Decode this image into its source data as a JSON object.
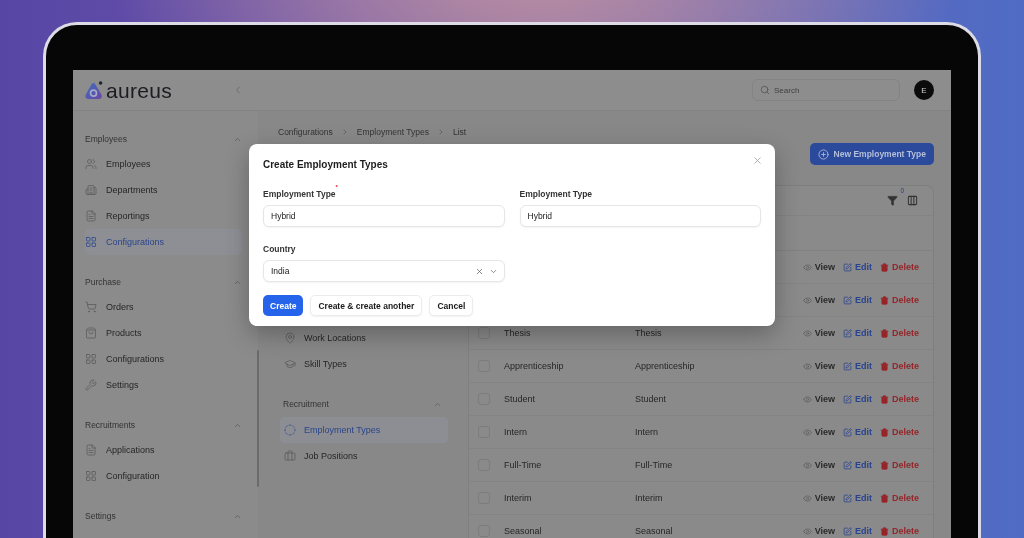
{
  "logo": {
    "text": "aureus"
  },
  "topbar": {
    "search": {
      "placeholder": "Search"
    },
    "avatar": "E"
  },
  "sidebar": {
    "groups": [
      {
        "label": "Employees",
        "expanded": true,
        "items": [
          {
            "label": "Employees",
            "selected": false
          },
          {
            "label": "Departments",
            "selected": false
          },
          {
            "label": "Reportings",
            "selected": false
          },
          {
            "label": "Configurations",
            "selected": true
          }
        ]
      },
      {
        "label": "Purchase",
        "expanded": true,
        "items": [
          {
            "label": "Orders",
            "selected": false
          },
          {
            "label": "Products",
            "selected": false
          },
          {
            "label": "Configurations",
            "selected": false
          },
          {
            "label": "Settings",
            "selected": false
          }
        ]
      },
      {
        "label": "Recruitments",
        "expanded": true,
        "items": [
          {
            "label": "Applications",
            "selected": false
          },
          {
            "label": "Configuration",
            "selected": false
          }
        ]
      },
      {
        "label": "Settings",
        "expanded": true
      }
    ]
  },
  "breadcrumb": [
    "Configurations",
    "Employment Types",
    "List"
  ],
  "new_button": {
    "label": "New Employment Type"
  },
  "subnav": {
    "groups": [
      {
        "items": [
          {
            "label": "Work Locations",
            "selected": false
          },
          {
            "label": "Skill Types",
            "selected": false
          }
        ]
      },
      {
        "label": "Recruitment",
        "expanded": true,
        "items": [
          {
            "label": "Employment Types",
            "selected": true
          },
          {
            "label": "Job Positions",
            "selected": false
          }
        ]
      }
    ]
  },
  "table": {
    "filter_count": "0",
    "rows": [
      {
        "actions": [
          {
            "kind": "view",
            "label": "View"
          },
          {
            "kind": "edit",
            "label": "Edit"
          },
          {
            "kind": "delete",
            "label": "Delete"
          }
        ]
      },
      {
        "actions": [
          {
            "kind": "view",
            "label": "View"
          },
          {
            "kind": "edit",
            "label": "Edit"
          },
          {
            "kind": "delete",
            "label": "Delete"
          }
        ]
      },
      {
        "cells": [
          "Thesis",
          "Thesis"
        ],
        "checked": false,
        "actions": [
          {
            "kind": "view",
            "label": "View"
          },
          {
            "kind": "edit",
            "label": "Edit"
          },
          {
            "kind": "delete",
            "label": "Delete"
          }
        ]
      },
      {
        "cells": [
          "Apprenticeship",
          "Apprenticeship"
        ],
        "checked": false,
        "actions": [
          {
            "kind": "view",
            "label": "View"
          },
          {
            "kind": "edit",
            "label": "Edit"
          },
          {
            "kind": "delete",
            "label": "Delete"
          }
        ]
      },
      {
        "cells": [
          "Student",
          "Student"
        ],
        "checked": false,
        "actions": [
          {
            "kind": "view",
            "label": "View"
          },
          {
            "kind": "edit",
            "label": "Edit"
          },
          {
            "kind": "delete",
            "label": "Delete"
          }
        ]
      },
      {
        "cells": [
          "Intern",
          "Intern"
        ],
        "checked": false,
        "actions": [
          {
            "kind": "view",
            "label": "View"
          },
          {
            "kind": "edit",
            "label": "Edit"
          },
          {
            "kind": "delete",
            "label": "Delete"
          }
        ]
      },
      {
        "cells": [
          "Full-Time",
          "Full-Time"
        ],
        "checked": false,
        "actions": [
          {
            "kind": "view",
            "label": "View"
          },
          {
            "kind": "edit",
            "label": "Edit"
          },
          {
            "kind": "delete",
            "label": "Delete"
          }
        ]
      },
      {
        "cells": [
          "Interim",
          "Interim"
        ],
        "checked": false,
        "actions": [
          {
            "kind": "view",
            "label": "View"
          },
          {
            "kind": "edit",
            "label": "Edit"
          },
          {
            "kind": "delete",
            "label": "Delete"
          }
        ]
      },
      {
        "cells": [
          "Seasonal",
          "Seasonal"
        ],
        "checked": false,
        "actions": [
          {
            "kind": "view",
            "label": "View"
          },
          {
            "kind": "edit",
            "label": "Edit"
          },
          {
            "kind": "delete",
            "label": "Delete"
          }
        ]
      }
    ]
  },
  "modal": {
    "title": "Create Employment Types",
    "fields": [
      {
        "kind": "text",
        "label": "Employment Type$^{*}$",
        "value": "Hybrid"
      },
      {
        "kind": "text",
        "label": "Employment Type",
        "value": "Hybrid"
      },
      {
        "kind": "select",
        "label": "Country",
        "value": "India"
      }
    ],
    "buttons": [
      {
        "kind": "primary",
        "label": "Create"
      },
      {
        "kind": "secondary",
        "label": "Create & create another"
      },
      {
        "kind": "secondary",
        "label": "Cancel"
      }
    ]
  }
}
